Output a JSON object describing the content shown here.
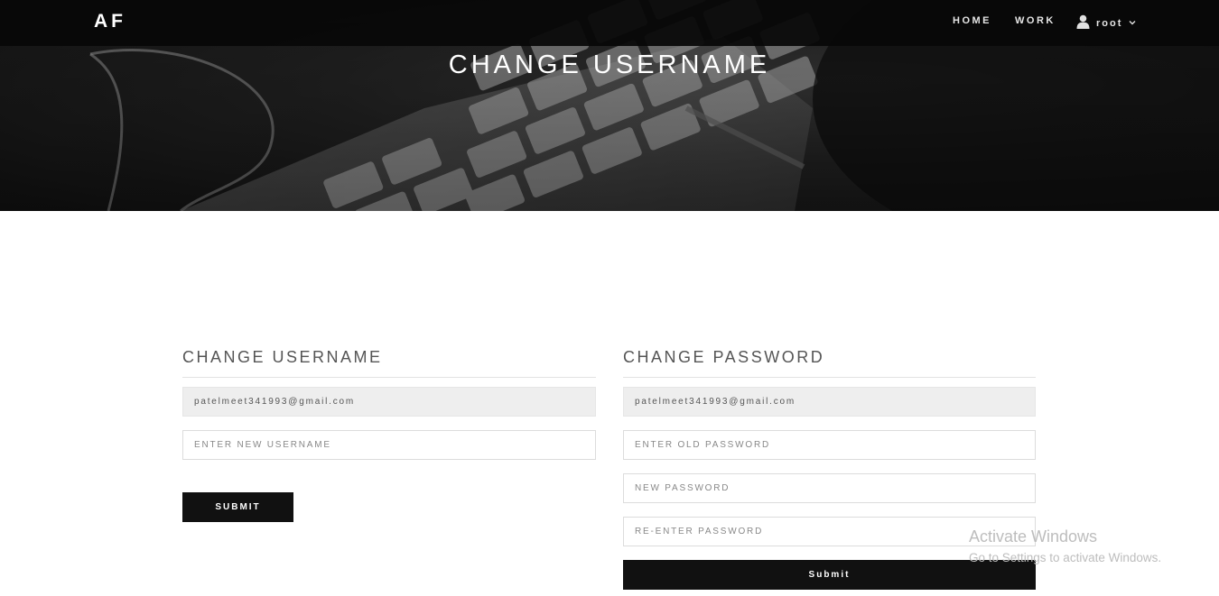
{
  "nav": {
    "brand": "AF",
    "links": [
      {
        "label": "HOME"
      },
      {
        "label": "WORK"
      }
    ],
    "user": {
      "label": "root",
      "icon": "user-icon",
      "caret": "chevron-down-icon"
    }
  },
  "hero": {
    "title": "CHANGE USERNAME"
  },
  "username_form": {
    "title": "CHANGE USERNAME",
    "email_value": "patelmeet341993@gmail.com",
    "new_username_placeholder": "ENTER NEW USERNAME",
    "submit_label": "SUBMIT"
  },
  "password_form": {
    "title": "CHANGE PASSWORD",
    "email_value": "patelmeet341993@gmail.com",
    "old_password_placeholder": "ENTER OLD PASSWORD",
    "new_password_placeholder": "NEW PASSWORD",
    "reenter_password_placeholder": "RE-ENTER PASSWORD",
    "submit_label": "Submit"
  },
  "watermark": {
    "title": "Activate Windows",
    "subtitle": "Go to Settings to activate Windows."
  },
  "colors": {
    "navbar": "#080808",
    "button": "#111111",
    "readonly_field": "#eeeeee",
    "heading_text": "#555555"
  }
}
